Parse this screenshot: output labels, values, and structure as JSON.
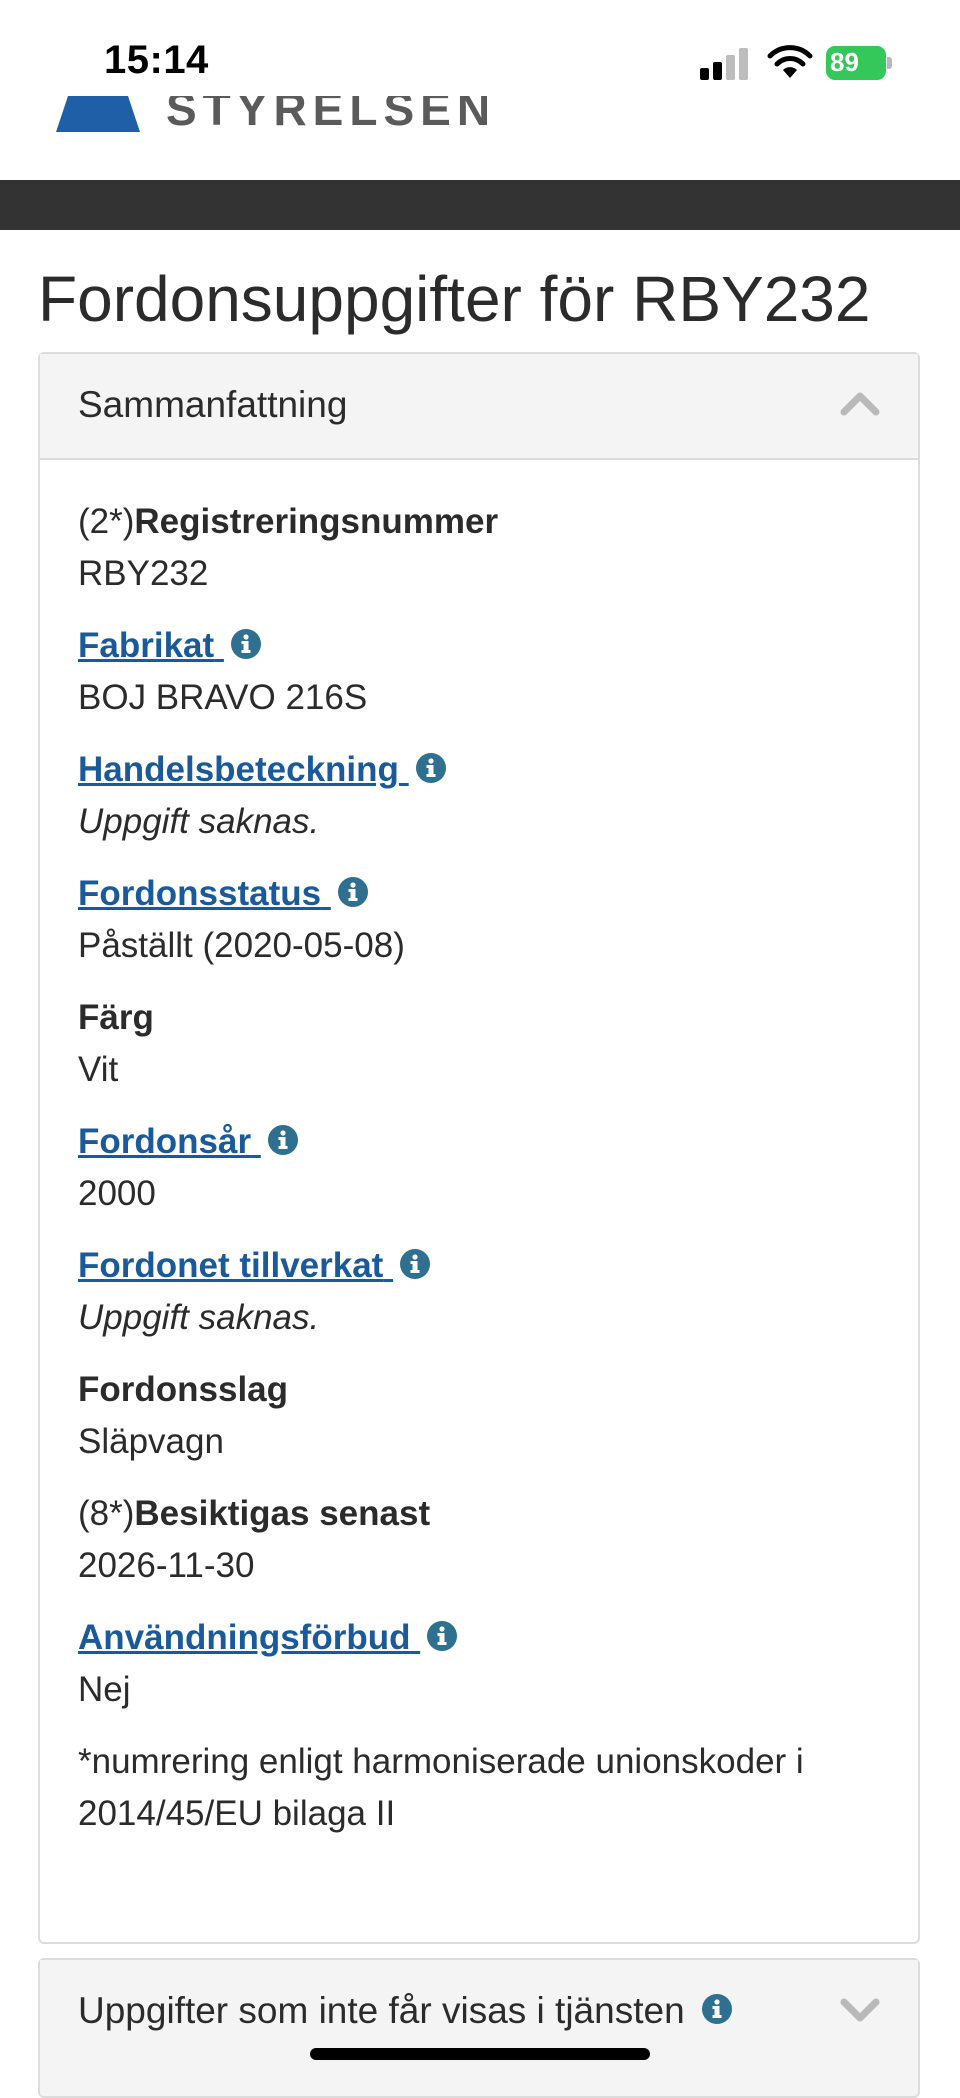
{
  "status_bar": {
    "time": "15:14",
    "battery_level": "89",
    "icons": [
      "signal-icon",
      "wifi-icon",
      "battery-charging-icon"
    ]
  },
  "header": {
    "logo_text": "STYRELSEN",
    "logo_color": "#1f5fa8",
    "bar_color": "#333333"
  },
  "page": {
    "title": "Fordonsuppgifter för RBY232"
  },
  "summary_panel": {
    "heading": "Sammanfattning",
    "expanded": true,
    "fields": [
      {
        "prefix": "(2*)",
        "label": "Registreringsnummer",
        "value": "RBY232"
      },
      {
        "label": "Fabrikat",
        "value": "BOJ BRAVO 216S"
      },
      {
        "label": "Handelsbeteckning",
        "value": "Uppgift saknas."
      },
      {
        "label": "Fordonsstatus",
        "value": "Påställt (2020-05-08)"
      },
      {
        "label": "Färg",
        "value": "Vit"
      },
      {
        "label": "Fordonsår",
        "value": "2000"
      },
      {
        "label": "Fordonet tillverkat",
        "value": "Uppgift saknas."
      },
      {
        "label": "Fordonsslag",
        "value": "Släpvagn"
      },
      {
        "prefix": "(8*)",
        "label": "Besiktigas senast",
        "value": "2026-11-30"
      },
      {
        "label": "Användningsförbud",
        "value": "Nej"
      }
    ],
    "footnote": "*numrering enligt harmoniserade unionskoder i 2014/45/EU bilaga II"
  },
  "restricted_panel": {
    "heading": "Uppgifter som inte får visas i tjänsten",
    "expanded": false
  },
  "colors": {
    "link": "#1a5a9a",
    "info_icon": "#2f6f8f",
    "panel_heading_bg": "#f4f4f4"
  }
}
